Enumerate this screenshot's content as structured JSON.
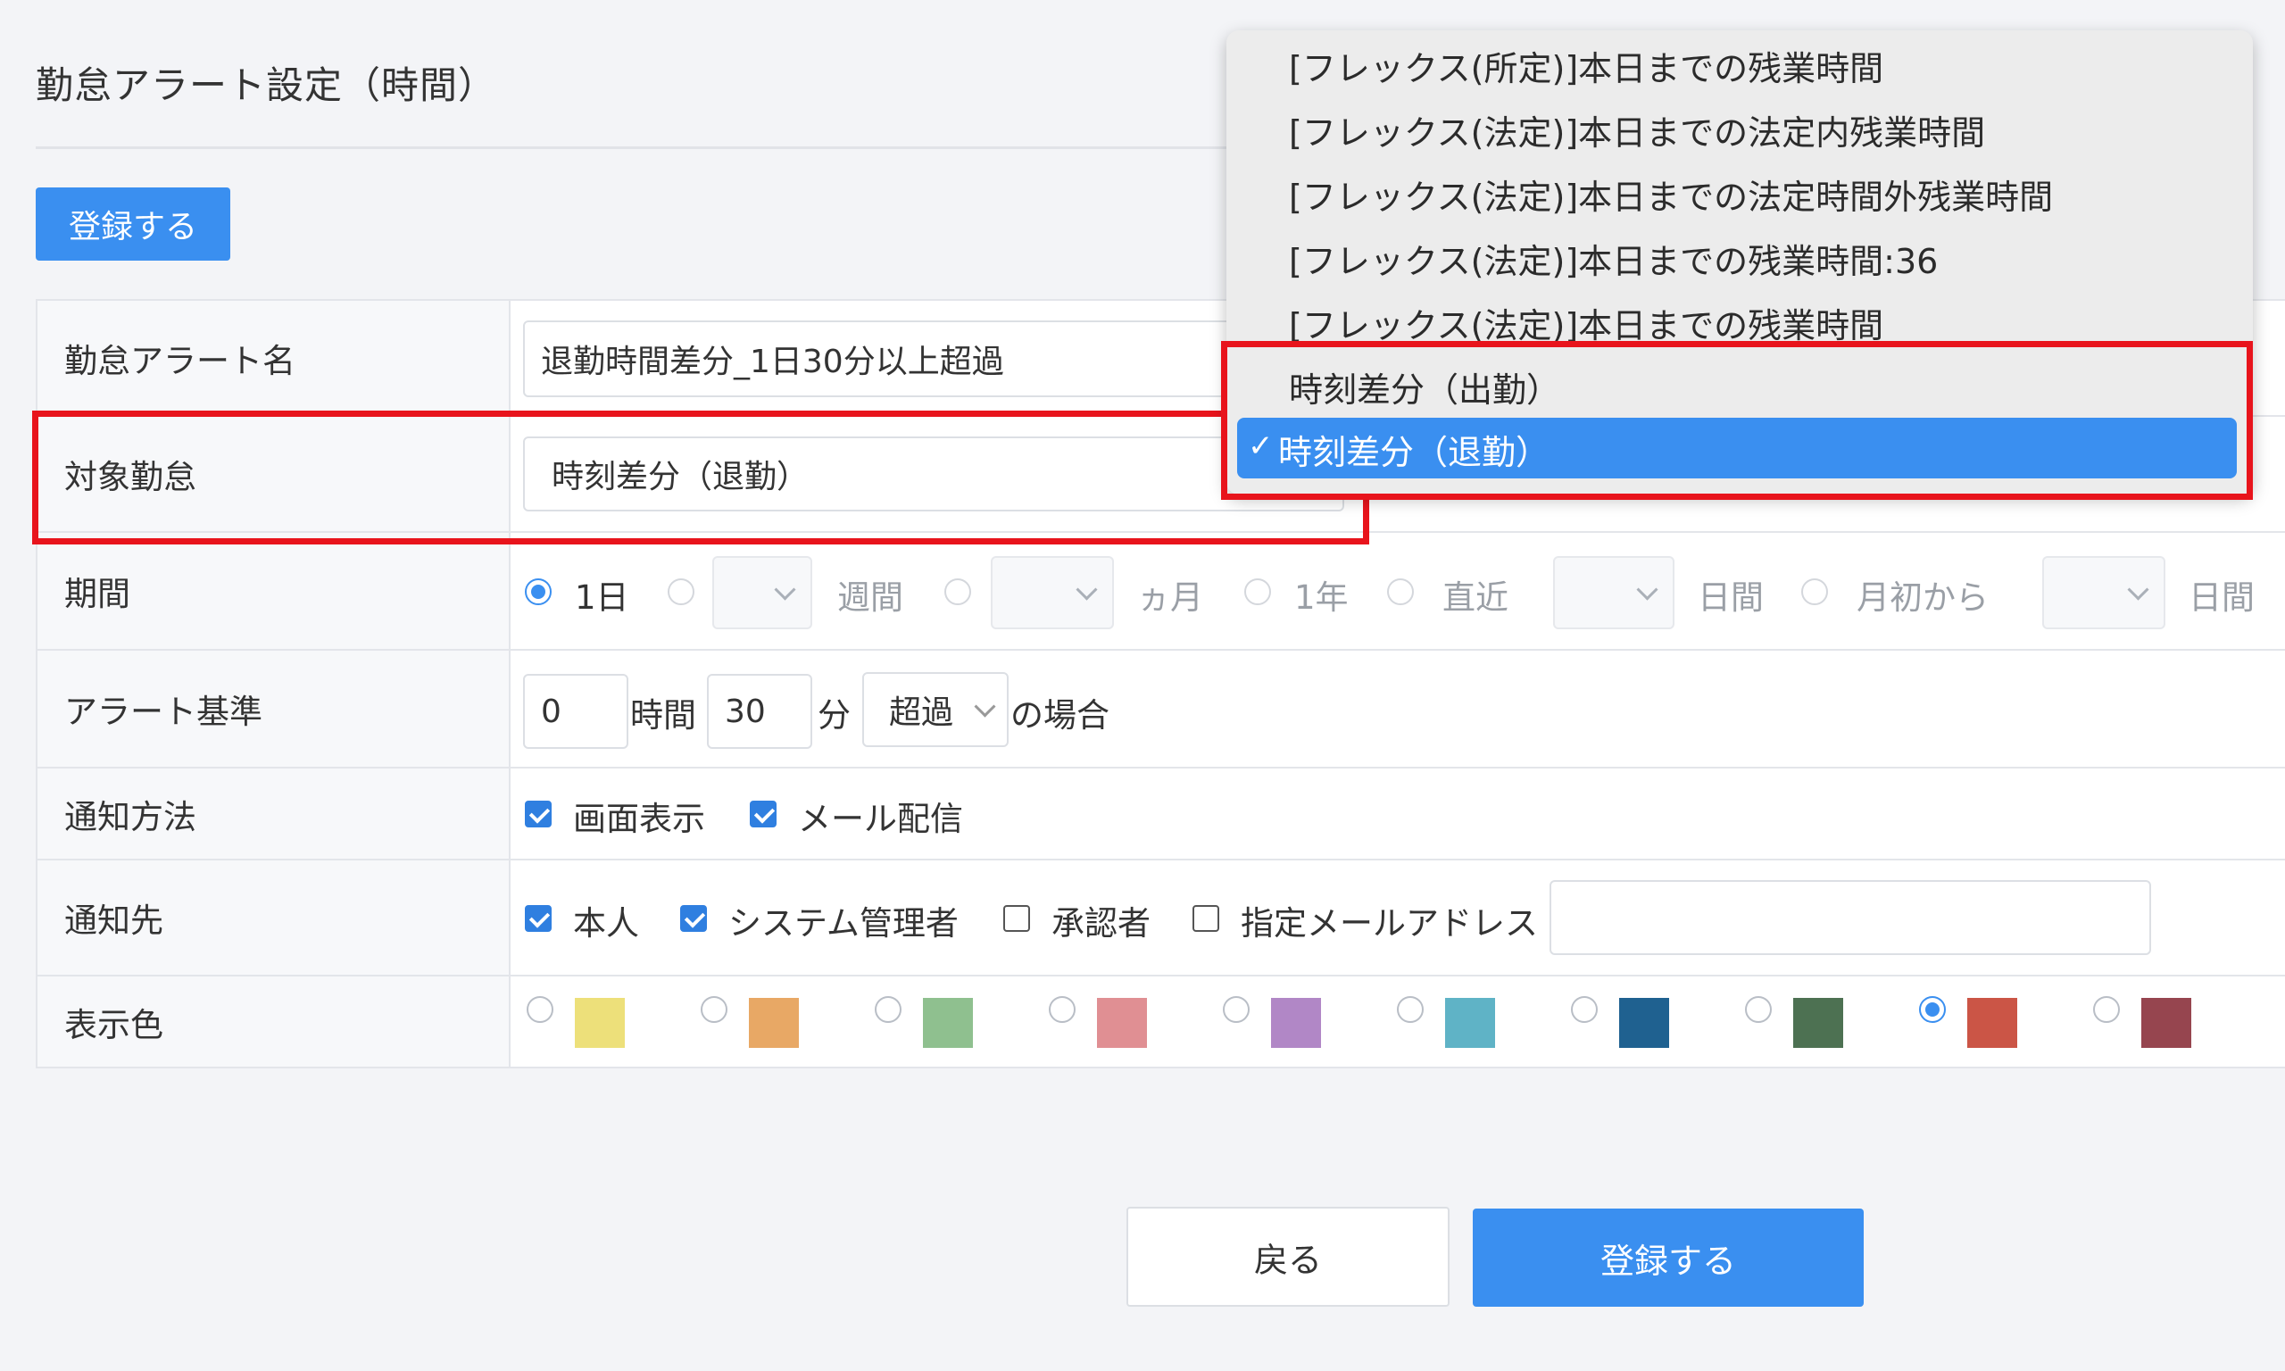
{
  "page": {
    "title": "勤怠アラート設定（時間）"
  },
  "actions": {
    "register_label": "登録する",
    "back_label": "戻る"
  },
  "form": {
    "name": {
      "label": "勤怠アラート名",
      "value": "退勤時間差分_1日30分以上超過"
    },
    "target": {
      "label": "対象勤怠",
      "value": "時刻差分（退勤）"
    },
    "period": {
      "label": "期間",
      "options": {
        "day": "1日",
        "week_unit": "週間",
        "month_unit": "ヵ月",
        "year": "1年",
        "recent": "直近",
        "recent_unit": "日間",
        "month_start": "月初から",
        "month_start_unit": "日間"
      },
      "selected": "1日"
    },
    "criteria": {
      "label": "アラート基準",
      "hours": "0",
      "hours_unit": "時間",
      "minutes": "30",
      "minutes_unit": "分",
      "condition": "超過",
      "suffix": "の場合"
    },
    "method": {
      "label": "通知方法",
      "screen": {
        "label": "画面表示",
        "checked": true
      },
      "mail": {
        "label": "メール配信",
        "checked": true
      }
    },
    "destination": {
      "label": "通知先",
      "self": {
        "label": "本人",
        "checked": true
      },
      "sysadmin": {
        "label": "システム管理者",
        "checked": true
      },
      "approver": {
        "label": "承認者",
        "checked": false
      },
      "email": {
        "label": "指定メールアドレス",
        "checked": false,
        "value": ""
      }
    },
    "color": {
      "label": "表示色",
      "swatches": [
        "#ede07a",
        "#e8a865",
        "#8fc08f",
        "#e08f93",
        "#b187c6",
        "#5fb3c6",
        "#1f6190",
        "#4d7152",
        "#cb5546",
        "#96454f"
      ],
      "selected_index": 8
    }
  },
  "dropdown": {
    "items": [
      "[フレックス(所定)]本日までの残業時間",
      "[フレックス(法定)]本日までの法定内残業時間",
      "[フレックス(法定)]本日までの法定時間外残業時間",
      "[フレックス(法定)]本日までの残業時間:36",
      "[フレックス(法定)]本日までの残業時間",
      "時刻差分（出勤）"
    ],
    "selected": "時刻差分（退勤）"
  }
}
